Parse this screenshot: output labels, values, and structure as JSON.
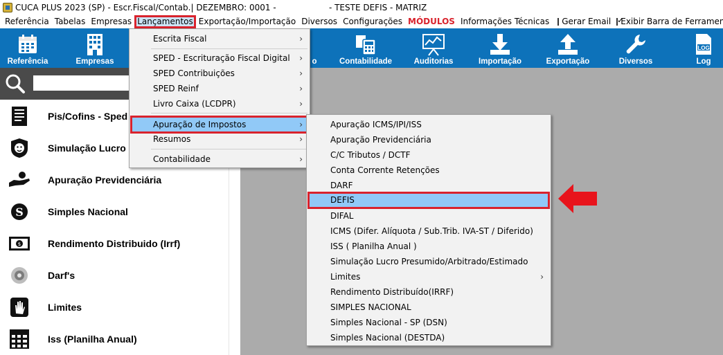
{
  "window": {
    "title": "CUCA PLUS 2023 (SP) - Escr.Fiscal/Contab.| DEZEMBRO: 0001 -                    - TESTE DEFIS - MATRIZ"
  },
  "menubar": {
    "items": [
      "Referência",
      "Tabelas",
      "Empresas",
      "Lançamentos",
      "Exportação/Importação",
      "Diversos",
      "Configurações"
    ],
    "modulos": "MÓDULOS",
    "info": "Informações Técnicas",
    "gerar_email": "Gerar Email",
    "exibir_barra": "Exibir Barra de Ferramentas"
  },
  "toolbar": {
    "items": [
      "Referência",
      "Empresas",
      "o",
      "Contabilidade",
      "Auditorias",
      "Importação",
      "Exportação",
      "Diversos",
      "Log"
    ]
  },
  "search": {
    "placeholder": ""
  },
  "left_panel": {
    "items": [
      "Pis/Cofins - Sped",
      "Simulação Lucro P",
      "Apuração Previdenciária",
      "Simples Nacional",
      "Rendimento Distribuido (Irrf)",
      "Darf's",
      "Limites",
      "Iss (Planilha Anual)"
    ]
  },
  "lancamentos_menu": {
    "items": [
      "Escrita Fiscal",
      "SPED - Escrituração Fiscal Digital",
      "SPED Contribuições",
      "SPED Reinf",
      "Livro Caixa (LCDPR)",
      "Apuração de Impostos",
      "Resumos",
      "Contabilidade"
    ]
  },
  "apuracao_submenu": {
    "items": [
      "Apuração ICMS/IPI/ISS",
      "Apuração Previdenciária",
      "C/C Tributos / DCTF",
      "Conta Corrente Retenções",
      "DARF",
      "DEFIS",
      "DIFAL",
      "ICMS (Difer. Alíquota / Sub.Trib. IVA-ST / Diferido)",
      "ISS ( Planilha Anual )",
      "Simulação Lucro Presumido/Arbitrado/Estimado",
      "Limites",
      "Rendimento Distribuído(IRRF)",
      "SIMPLES NACIONAL",
      "Simples Nacional - SP (DSN)",
      "Simples Nacional  (DESTDA)"
    ]
  },
  "colors": {
    "toolbar": "#0d72ba",
    "highlight": "#91c9f7",
    "annotation": "#d9232d"
  }
}
